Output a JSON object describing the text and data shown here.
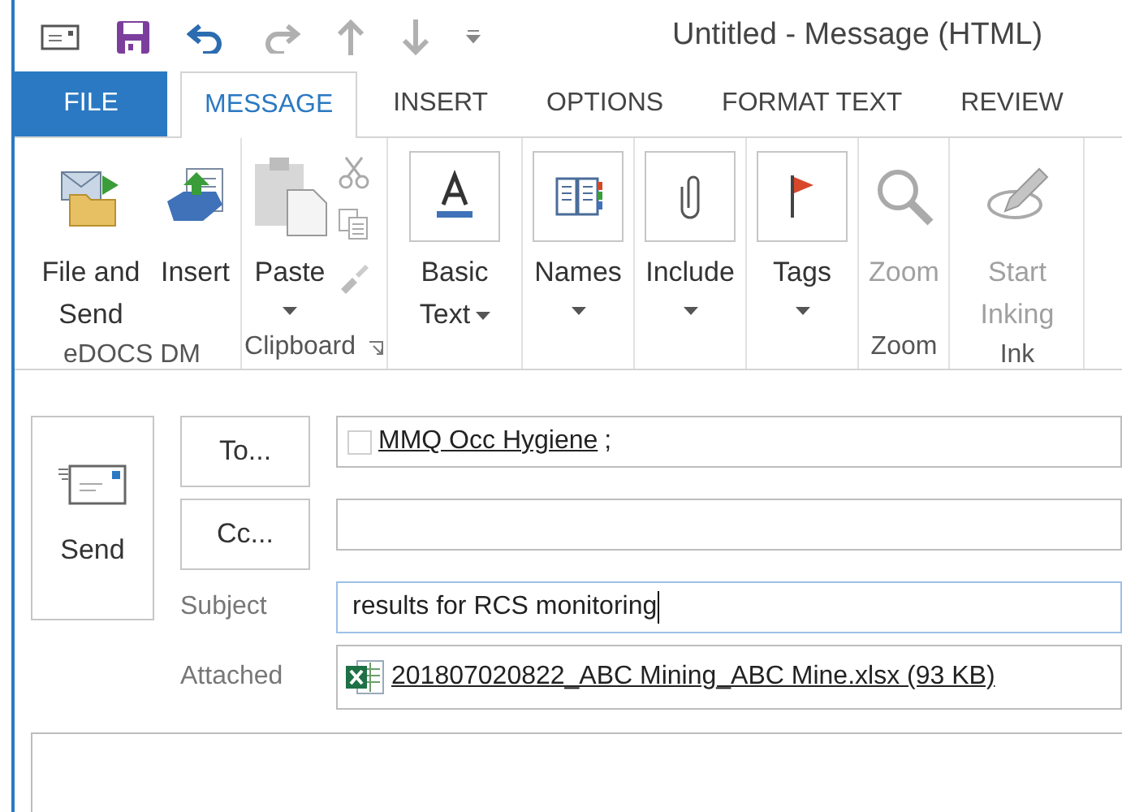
{
  "window": {
    "title": "Untitled - Message (HTML)"
  },
  "tabs": [
    {
      "label": "FILE",
      "kind": "file",
      "selected": false
    },
    {
      "label": "MESSAGE",
      "kind": "tab",
      "selected": true
    },
    {
      "label": "INSERT",
      "kind": "tab",
      "selected": false
    },
    {
      "label": "OPTIONS",
      "kind": "tab",
      "selected": false
    },
    {
      "label": "FORMAT TEXT",
      "kind": "tab",
      "selected": false
    },
    {
      "label": "REVIEW",
      "kind": "tab",
      "selected": false
    }
  ],
  "ribbon": {
    "groups": [
      {
        "label": "eDOCS DM",
        "launcher": false,
        "buttons": [
          {
            "label": "File and Send",
            "kind": "file-send",
            "dropdown": false,
            "disabled": false
          },
          {
            "label": "Insert",
            "kind": "insert",
            "dropdown": false,
            "disabled": false
          }
        ]
      },
      {
        "label": "Clipboard",
        "launcher": true,
        "buttons": [
          {
            "label": "Paste",
            "kind": "paste",
            "dropdown": true,
            "disabled": false
          }
        ]
      },
      {
        "buttons": [
          {
            "label": "Basic Text",
            "kind": "basic-text",
            "dropdown": true,
            "disabled": false
          }
        ]
      },
      {
        "buttons": [
          {
            "label": "Names",
            "kind": "names",
            "dropdown": true,
            "disabled": false
          }
        ]
      },
      {
        "buttons": [
          {
            "label": "Include",
            "kind": "include",
            "dropdown": true,
            "disabled": false
          }
        ]
      },
      {
        "buttons": [
          {
            "label": "Tags",
            "kind": "tags",
            "dropdown": true,
            "disabled": false
          }
        ]
      },
      {
        "label": "Zoom",
        "launcher": false,
        "buttons": [
          {
            "label": "Zoom",
            "kind": "zoom",
            "dropdown": false,
            "disabled": true
          }
        ]
      },
      {
        "label": "Ink",
        "launcher": false,
        "buttons": [
          {
            "label": "Start Inking",
            "kind": "ink",
            "dropdown": false,
            "disabled": true
          }
        ]
      }
    ]
  },
  "compose": {
    "send": "Send",
    "to_button": "To...",
    "cc_button": "Cc...",
    "to": [
      {
        "name": "MMQ Occ Hygiene",
        "suffix": ";",
        "checked": false
      }
    ],
    "subject_label": "Subject",
    "subject": "results for RCS monitoring",
    "attached_label": "Attached",
    "attachments": [
      {
        "name": "201807020822_ABC Mining_ABC Mine.xlsx (93 KB)"
      }
    ]
  }
}
